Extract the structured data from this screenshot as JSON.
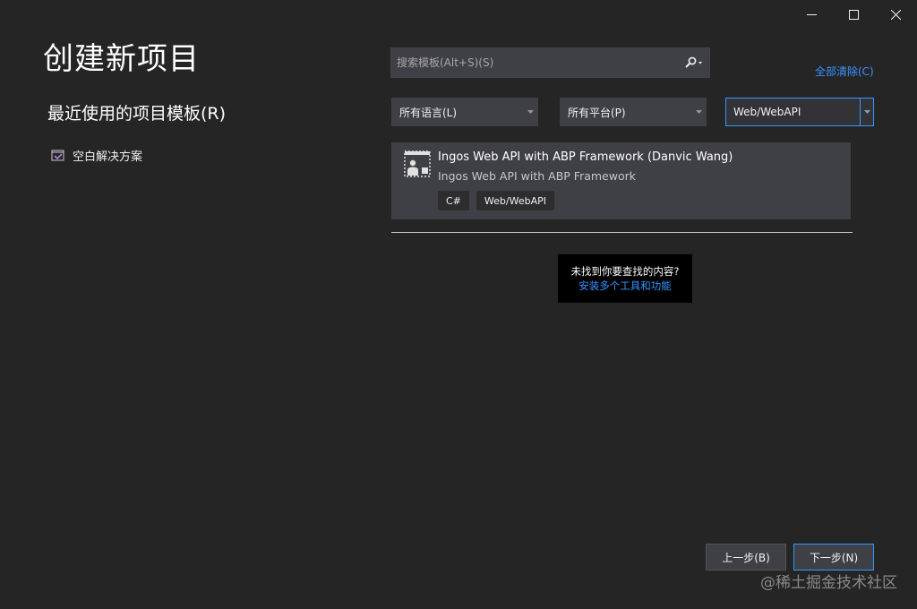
{
  "window": {
    "minimize_icon": "minimize-icon",
    "maximize_icon": "maximize-icon",
    "close_icon": "close-icon"
  },
  "page_title": "创建新项目",
  "recent": {
    "title": "最近使用的项目模板(R)",
    "items": [
      {
        "label": "空白解决方案",
        "icon": "blank-solution-icon"
      }
    ]
  },
  "search": {
    "placeholder": "搜索模板(Alt+S)(S)",
    "value": "",
    "icon": "search-icon"
  },
  "clear_all": "全部清除(C)",
  "filters": {
    "language": "所有语言(L)",
    "platform": "所有平台(P)",
    "project_type": "Web/WebAPI"
  },
  "templates": [
    {
      "title": "Ingos Web API with ABP Framework (Danvic Wang)",
      "description": "Ingos Web API with ABP Framework",
      "tags": [
        "C#",
        "Web/WebAPI"
      ],
      "icon": "web-api-template-icon"
    }
  ],
  "not_found": {
    "question": "未找到你要查找的内容?",
    "link": "安装多个工具和功能"
  },
  "buttons": {
    "back": "上一步(B)",
    "next": "下一步(N)"
  },
  "watermark": "@稀土掘金技术社区",
  "colors": {
    "background": "#252526",
    "control": "#3f3f46",
    "accent": "#3399ff",
    "link": "#3794ff"
  }
}
